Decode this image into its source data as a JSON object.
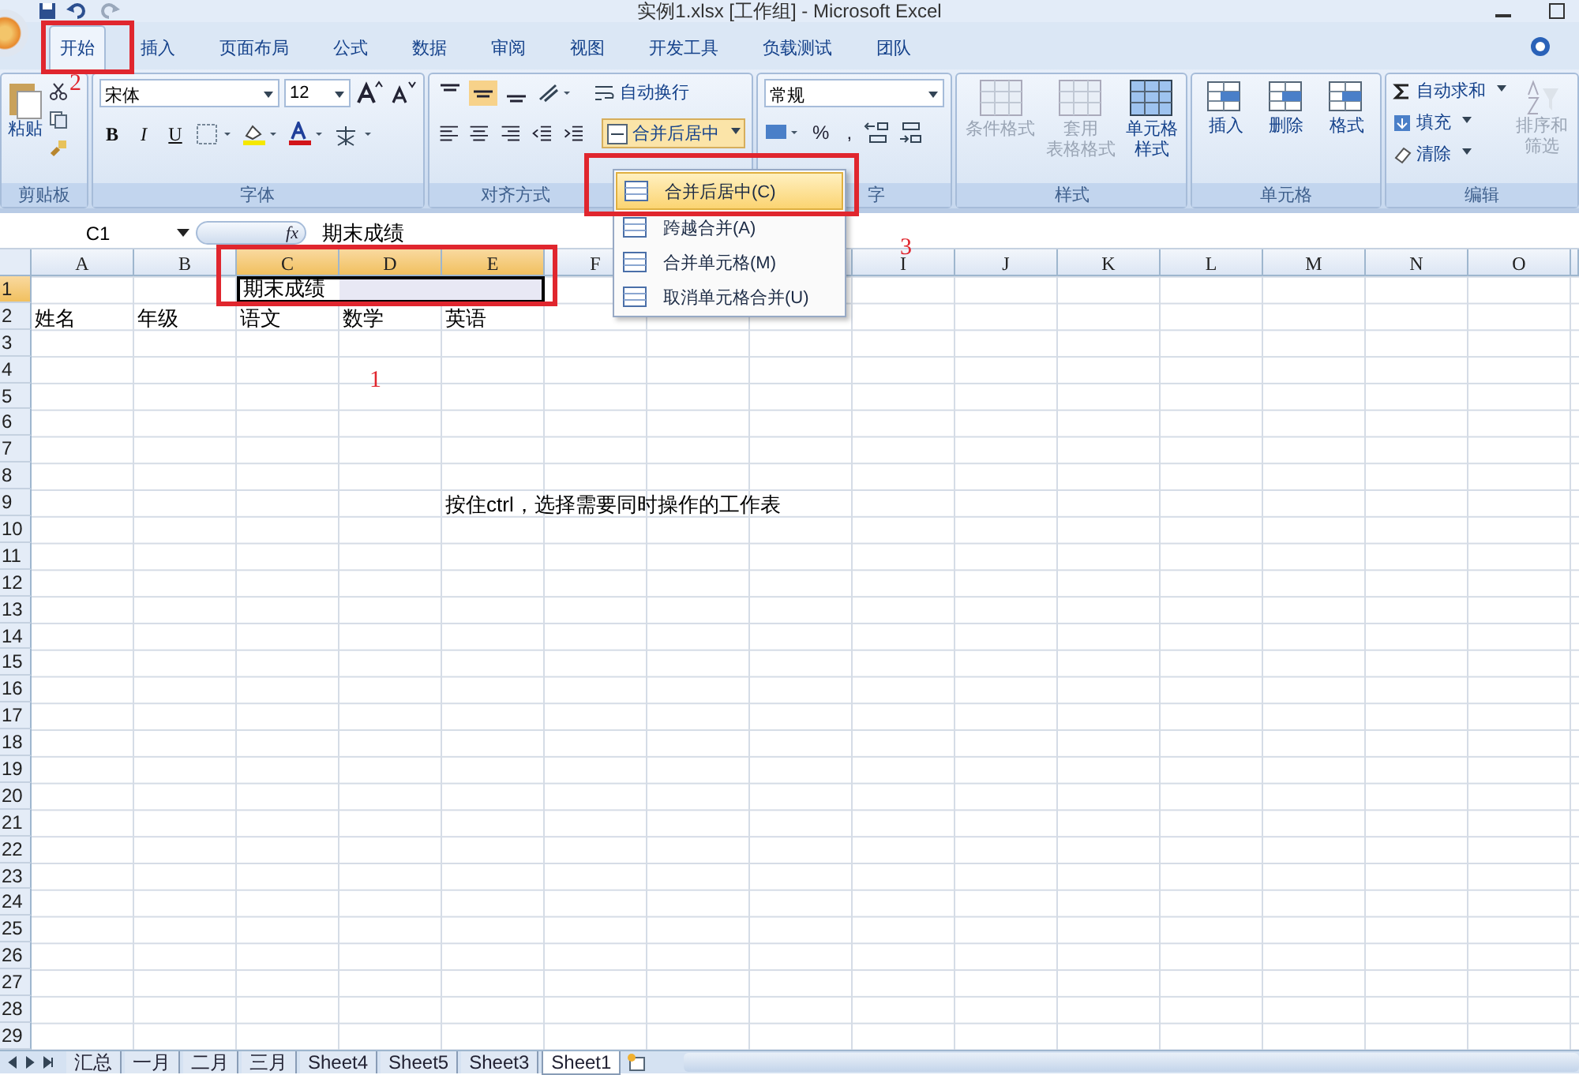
{
  "window": {
    "title": "实例1.xlsx [工作组] - Microsoft Excel"
  },
  "tabs": [
    {
      "label": "开始",
      "selected": true
    },
    {
      "label": "插入",
      "selected": false
    },
    {
      "label": "页面布局",
      "selected": false
    },
    {
      "label": "公式",
      "selected": false
    },
    {
      "label": "数据",
      "selected": false
    },
    {
      "label": "审阅",
      "selected": false
    },
    {
      "label": "视图",
      "selected": false
    },
    {
      "label": "开发工具",
      "selected": false
    },
    {
      "label": "负载测试",
      "selected": false
    },
    {
      "label": "团队",
      "selected": false
    }
  ],
  "ribbon": {
    "clipboard": {
      "label": "剪贴板",
      "paste": "粘贴"
    },
    "font": {
      "label": "字体",
      "family": "宋体",
      "size": "12",
      "bold": "B",
      "italic": "I",
      "underline": "U"
    },
    "alignment": {
      "label": "对齐方式",
      "wrap": "自动换行",
      "merge": "合并后居中"
    },
    "number": {
      "label": "字",
      "format": "常规",
      "percent": "%",
      "comma": ","
    },
    "styles": {
      "label": "样式",
      "buttons": [
        {
          "lines": [
            "条件格式"
          ],
          "disabled": true
        },
        {
          "lines": [
            "套用",
            "表格格式"
          ],
          "disabled": true
        },
        {
          "lines": [
            "单元格",
            "样式"
          ],
          "disabled": false
        }
      ]
    },
    "cells": {
      "label": "单元格",
      "buttons": [
        "插入",
        "删除",
        "格式"
      ]
    },
    "editing": {
      "label": "编辑",
      "items": [
        {
          "kind": "sum",
          "label": "自动求和"
        },
        {
          "kind": "fill",
          "label": "填充"
        },
        {
          "kind": "clear",
          "label": "清除"
        }
      ],
      "sort": {
        "lines": [
          "排序和",
          "筛选"
        ],
        "disabled": true
      }
    }
  },
  "formula_bar": {
    "name_box": "C1",
    "function_label": "fx",
    "value": "期末成绩"
  },
  "sheet": {
    "columns": [
      {
        "label": "A",
        "selected": false
      },
      {
        "label": "B",
        "selected": false
      },
      {
        "label": "C",
        "selected": true
      },
      {
        "label": "D",
        "selected": true
      },
      {
        "label": "E",
        "selected": true
      },
      {
        "label": "F",
        "selected": false
      },
      {},
      {},
      {
        "label": "I",
        "selected": false
      },
      {
        "label": "J",
        "selected": false
      },
      {
        "label": "K",
        "selected": false
      },
      {
        "label": "L",
        "selected": false
      },
      {
        "label": "M",
        "selected": false
      },
      {
        "label": "N",
        "selected": false
      },
      {
        "label": "O",
        "selected": false
      }
    ],
    "rows": [
      {
        "label": "1",
        "selected": true,
        "cells": [
          {},
          {},
          {
            "text": "期末成绩",
            "selected": true
          },
          {
            "selected": true
          },
          {
            "selected": true
          }
        ]
      },
      {
        "label": "2",
        "selected": false,
        "cells": [
          {
            "text": "姓名"
          },
          {
            "text": "年级"
          },
          {
            "text": "语文"
          },
          {
            "text": "数学"
          },
          {
            "text": "英语"
          }
        ]
      },
      {
        "label": "3",
        "selected": false
      },
      {
        "label": "4",
        "selected": false
      },
      {
        "label": "5",
        "selected": false
      },
      {
        "label": "6",
        "selected": false
      },
      {
        "label": "7",
        "selected": false
      },
      {
        "label": "8",
        "selected": false
      },
      {
        "label": "9",
        "selected": false,
        "cells": [
          {},
          {},
          {},
          {},
          {
            "text": "按住ctrl，选择需要同时操作的工作表"
          }
        ]
      },
      {
        "label": "10",
        "selected": false
      },
      {
        "label": "11",
        "selected": false
      },
      {
        "label": "12",
        "selected": false
      },
      {
        "label": "13",
        "selected": false
      },
      {
        "label": "14",
        "selected": false
      },
      {
        "label": "15",
        "selected": false
      },
      {
        "label": "16",
        "selected": false
      },
      {
        "label": "17",
        "selected": false
      },
      {
        "label": "18",
        "selected": false
      },
      {
        "label": "19",
        "selected": false
      },
      {
        "label": "20",
        "selected": false
      },
      {
        "label": "21",
        "selected": false
      },
      {
        "label": "22",
        "selected": false
      },
      {
        "label": "23",
        "selected": false
      },
      {
        "label": "24",
        "selected": false
      },
      {
        "label": "25",
        "selected": false
      },
      {
        "label": "26",
        "selected": false
      },
      {
        "label": "27",
        "selected": false
      },
      {
        "label": "28",
        "selected": false
      },
      {
        "label": "29",
        "selected": false
      }
    ]
  },
  "merge_menu": {
    "items": [
      {
        "label": "合并后居中(C)",
        "selected": true
      },
      {
        "label": "跨越合并(A)",
        "selected": false
      },
      {
        "label": "合并单元格(M)",
        "selected": false
      },
      {
        "label": "取消单元格合并(U)",
        "selected": false
      }
    ]
  },
  "sheet_tabs": [
    {
      "label": "汇总",
      "selected": false
    },
    {
      "label": "一月",
      "selected": false
    },
    {
      "label": "二月",
      "selected": false
    },
    {
      "label": "三月",
      "selected": false
    },
    {
      "label": "Sheet4",
      "selected": false
    },
    {
      "label": "Sheet5",
      "selected": false
    },
    {
      "label": "Sheet3",
      "selected": false
    },
    {
      "label": "Sheet1",
      "selected": true
    }
  ],
  "annotations": [
    "2",
    "3",
    "1"
  ]
}
